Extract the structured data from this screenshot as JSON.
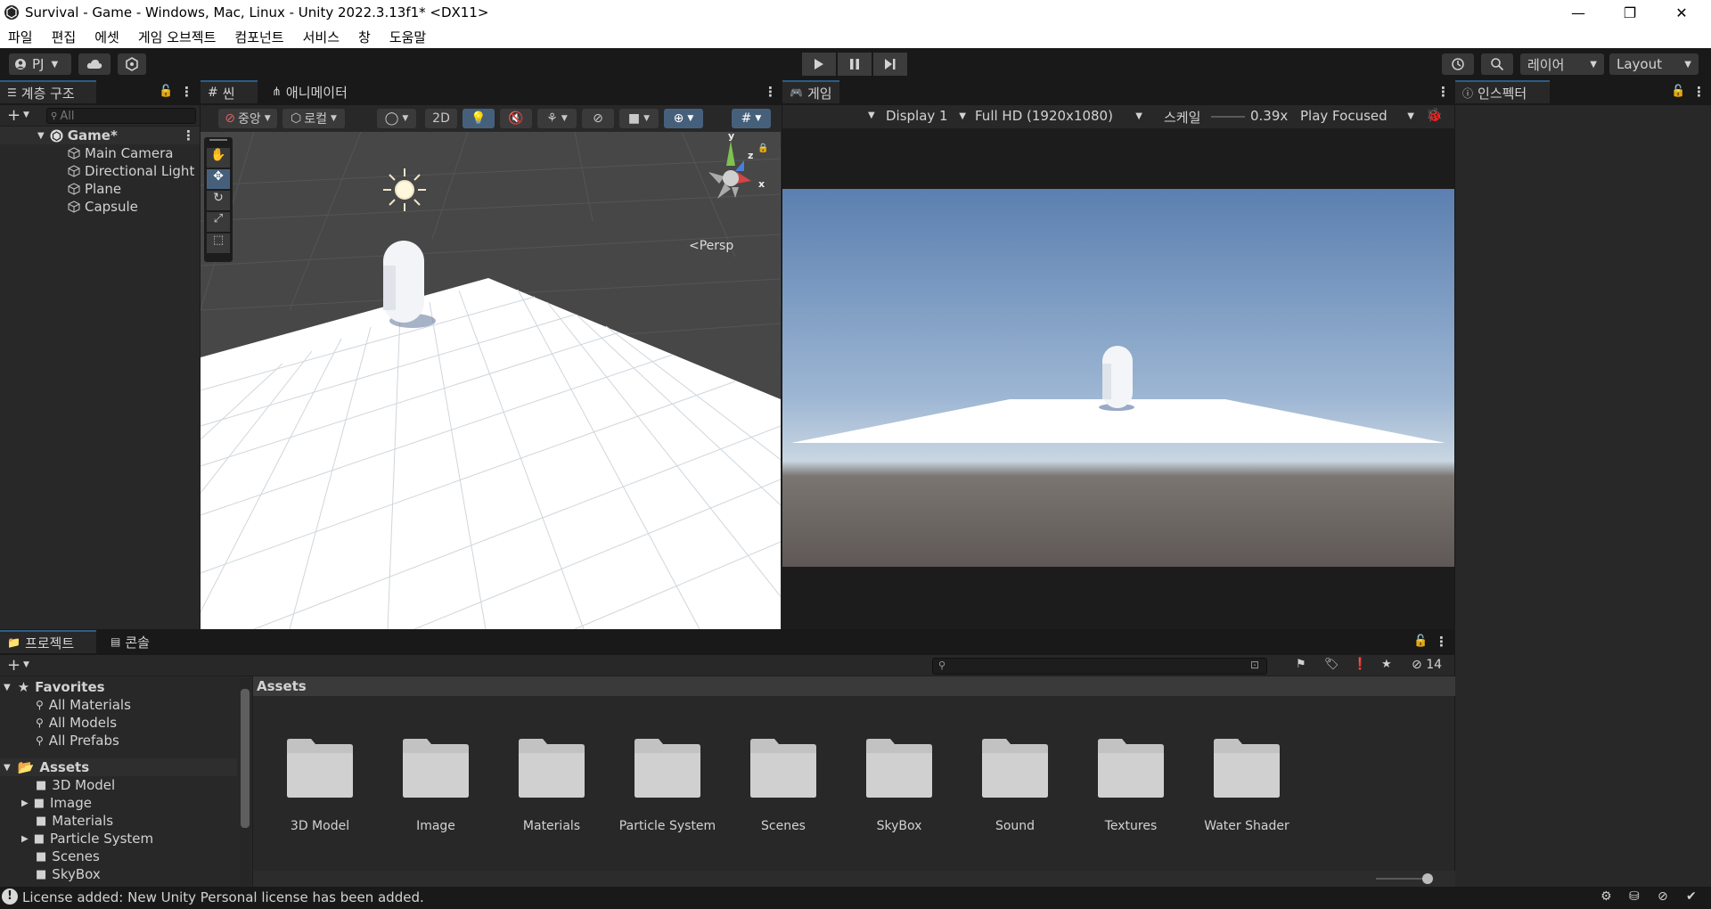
{
  "window": {
    "title": "Survival - Game - Windows, Mac, Linux - Unity 2022.3.13f1* <DX11>",
    "minimize_glyph": "—",
    "maximize_glyph": "❐",
    "close_glyph": "✕"
  },
  "menu": [
    "파일",
    "편집",
    "에셋",
    "게임 오브젝트",
    "컴포넌트",
    "서비스",
    "창",
    "도움말"
  ],
  "toolbar": {
    "account_label": "PJ",
    "layers_label": "레이어",
    "layout_label": "Layout"
  },
  "hierarchy": {
    "tab_label": "계층 구조",
    "search_placeholder": "All",
    "scene_name": "Game*",
    "items": [
      "Main Camera",
      "Directional Light",
      "Plane",
      "Capsule"
    ]
  },
  "scene_view": {
    "tab_label": "씬",
    "animator_tab_label": "애니메이터",
    "pivot_label": "중앙",
    "space_label": "로컬",
    "mode_2d_label": "2D",
    "persp_label": "Persp",
    "gizmo_axes": {
      "x": "x",
      "y": "y",
      "z": "z"
    }
  },
  "game_view": {
    "tab_label": "게임",
    "display_label": "Display 1",
    "resolution_label": "Full HD (1920x1080)",
    "scale_label": "스케일",
    "scale_value": "0.39x",
    "play_mode_label": "Play Focused"
  },
  "inspector": {
    "tab_label": "인스펙터"
  },
  "project": {
    "tab_label": "프로젝트",
    "console_tab_label": "콘솔",
    "hidden_count": "14",
    "favorites_label": "Favorites",
    "favorites": [
      "All Materials",
      "All Models",
      "All Prefabs"
    ],
    "assets_root_label": "Assets",
    "tree_items": [
      "3D Model",
      "Image",
      "Materials",
      "Particle System",
      "Scenes",
      "SkyBox"
    ],
    "breadcrumb": "Assets",
    "folders": [
      "3D Model",
      "Image",
      "Materials",
      "Particle System",
      "Scenes",
      "SkyBox",
      "Sound",
      "Textures",
      "Water Shader"
    ]
  },
  "status": {
    "message": "License added: New Unity Personal license has been added."
  },
  "colors": {
    "accent": "#2c5d87",
    "panel": "#282828",
    "toolbar": "#191919",
    "sky_top": "#5b7fb0",
    "ground": "#5f5856"
  }
}
